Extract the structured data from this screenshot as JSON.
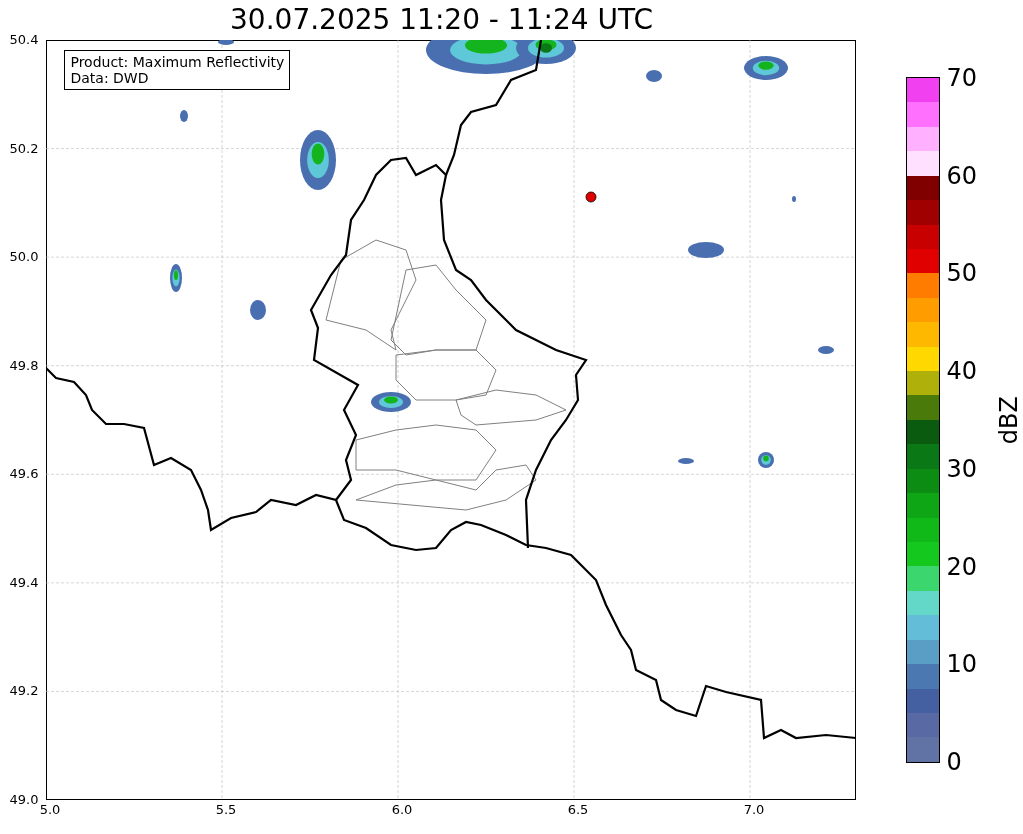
{
  "title": "30.07.2025 11:20 - 11:24 UTC",
  "legend": [
    "Product: Maximum Reflectivity",
    "Data: DWD"
  ],
  "x_ticks": [
    "5.0",
    "5.5",
    "6.0",
    "6.5",
    "7.0"
  ],
  "y_ticks": [
    "50.4",
    "50.2",
    "50.0",
    "49.8",
    "49.6",
    "49.4",
    "49.2",
    "49.0"
  ],
  "colorbar": {
    "label": "dBZ",
    "ticks": [
      "70",
      "60",
      "50",
      "40",
      "30",
      "20",
      "10",
      "0"
    ],
    "segments": [
      {
        "color": "#f040f0"
      },
      {
        "color": "#ff70ff"
      },
      {
        "color": "#ffb0ff"
      },
      {
        "color": "#ffe0ff"
      },
      {
        "color": "#800000"
      },
      {
        "color": "#a00000"
      },
      {
        "color": "#c80000"
      },
      {
        "color": "#e00000"
      },
      {
        "color": "#ff7c00"
      },
      {
        "color": "#ff9c00"
      },
      {
        "color": "#ffb800"
      },
      {
        "color": "#ffd800"
      },
      {
        "color": "#b0b00a"
      },
      {
        "color": "#4a7a0a"
      },
      {
        "color": "#0a5a10"
      },
      {
        "color": "#0a7814"
      },
      {
        "color": "#0c8c12"
      },
      {
        "color": "#0ea614"
      },
      {
        "color": "#10b818"
      },
      {
        "color": "#14c81e"
      },
      {
        "color": "#3cd66e"
      },
      {
        "color": "#64d8c8"
      },
      {
        "color": "#63bcd8"
      },
      {
        "color": "#5a9ec6"
      },
      {
        "color": "#4b78b0"
      },
      {
        "color": "#4460a0"
      },
      {
        "color": "#5869a3"
      },
      {
        "color": "#6173a5"
      }
    ]
  }
}
